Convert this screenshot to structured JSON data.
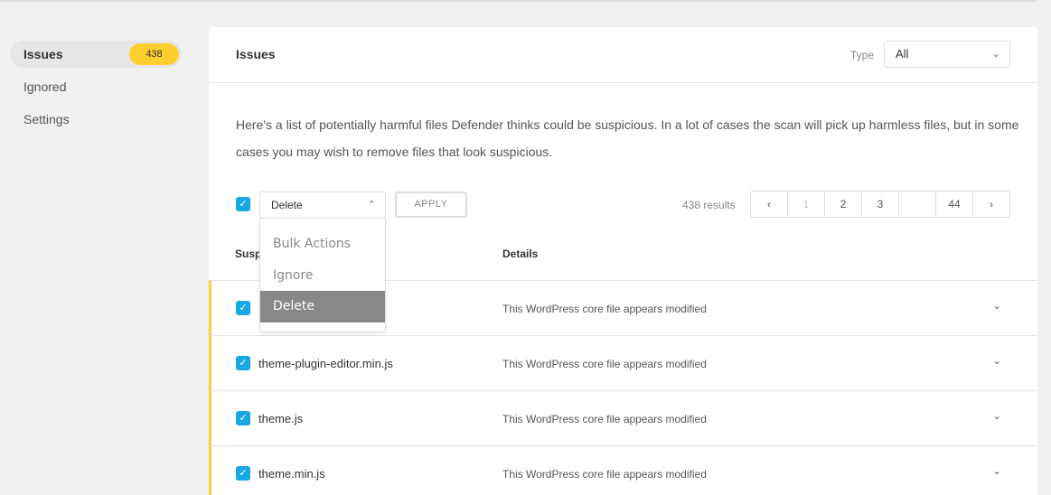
{
  "sidebar": {
    "items": [
      {
        "label": "Issues",
        "badge": "438"
      },
      {
        "label": "Ignored"
      },
      {
        "label": "Settings"
      }
    ]
  },
  "panel": {
    "title": "Issues",
    "type_label": "Type",
    "type_value": "All",
    "description": "Here's a list of potentially harmful files Defender thinks could be suspicious. In a lot of cases the scan will pick up harmless files, but in some cases you may wish to remove files that look suspicious."
  },
  "bulk": {
    "selected": "Delete",
    "apply_label": "APPLY",
    "options": [
      "Bulk Actions",
      "Ignore",
      "Delete"
    ]
  },
  "results": {
    "count_text": "438 results",
    "pages": [
      "1",
      "2",
      "3",
      "",
      "44"
    ]
  },
  "table": {
    "headers": {
      "suspicious": "Susp",
      "details": "Details"
    },
    "rows": [
      {
        "file": "",
        "detail": "This WordPress core file appears modified"
      },
      {
        "file": "theme-plugin-editor.min.js",
        "detail": "This WordPress core file appears modified"
      },
      {
        "file": "theme.js",
        "detail": "This WordPress core file appears modified"
      },
      {
        "file": "theme.min.js",
        "detail": "This WordPress core file appears modified"
      }
    ]
  },
  "colors": {
    "accent": "#17a8e3",
    "badge": "#fecf2f",
    "row_marker": "#fecf2f",
    "dropdown_selected": "#888888"
  }
}
